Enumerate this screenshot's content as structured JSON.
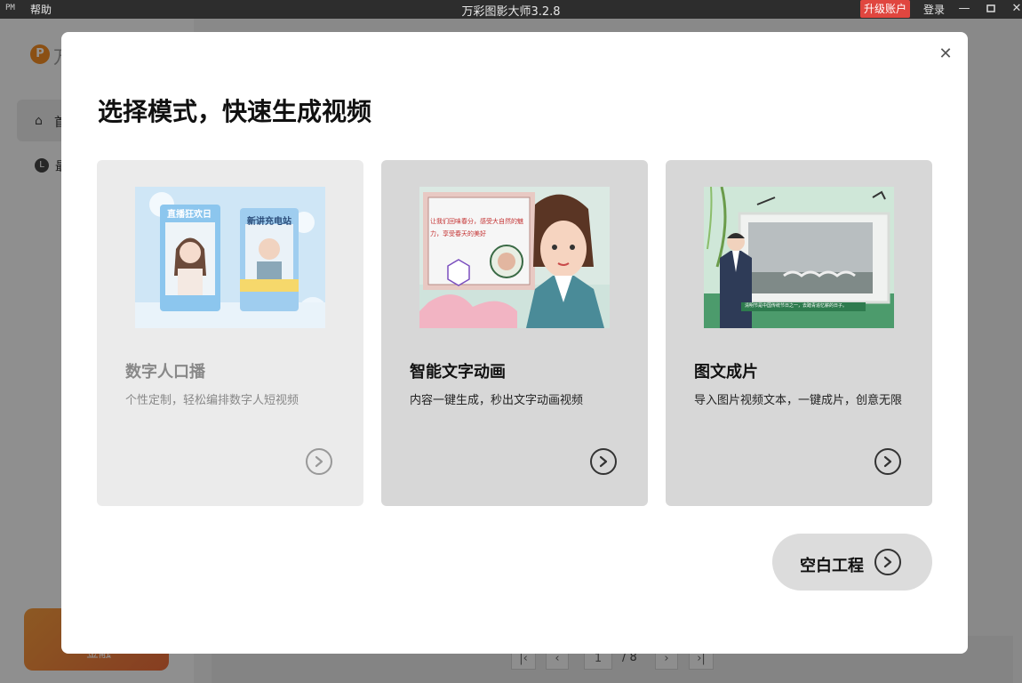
{
  "titlebar": {
    "pm": "PM",
    "help": "帮助",
    "app_title": "万彩图影大师3.2.8",
    "upgrade": "升级账户",
    "login": "登录"
  },
  "sidebar": {
    "logo_letter": "P",
    "logo_text": "万",
    "nav_home_label": "首",
    "nav_recent_label": "最",
    "promo_label": "金融"
  },
  "pager": {
    "current": "1",
    "total": "/ 8"
  },
  "modal": {
    "title": "选择模式，快速生成视频",
    "cards": [
      {
        "name": "数字人口播",
        "desc": "个性定制，轻松编排数字人短视频",
        "thumb_text_1": "直播狂欢日",
        "thumb_text_2": "新讲充电站"
      },
      {
        "name": "智能文字动画",
        "desc": "内容一键生成，秒出文字动画视频",
        "thumb_text": "让我们回味春分，感受大自然的魅力，享受春天的美好"
      },
      {
        "name": "图文成片",
        "desc": "导入图片视频文本，一键成片，创意无限",
        "thumb_caption": "清明节是中国传统节日之一，去踏青追忆薪的日子。"
      }
    ],
    "blank_button": "空白工程"
  },
  "colors": {
    "upgrade": "#e0463f",
    "promo": "#f08a24"
  }
}
